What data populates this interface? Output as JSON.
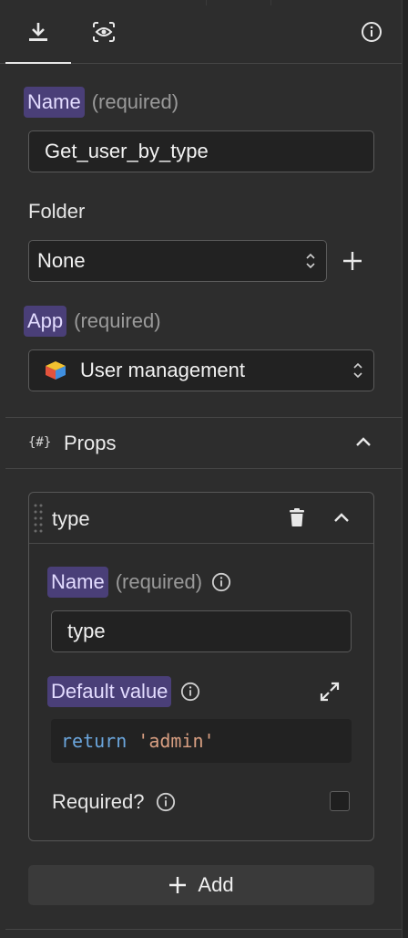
{
  "tabs": [
    {
      "icon": "download-icon",
      "active": true
    },
    {
      "icon": "eye-scan-icon",
      "active": false
    },
    {
      "icon": "info-icon",
      "active": false
    }
  ],
  "form": {
    "name_label": "Name",
    "name_required": "(required)",
    "name_value": "Get_user_by_type",
    "folder_label": "Folder",
    "folder_value": "None",
    "app_label": "App",
    "app_required": "(required)",
    "app_value": "User management"
  },
  "props": {
    "icon_text": "{#}",
    "title": "Props",
    "items": [
      {
        "title": "type",
        "name_label": "Name",
        "name_required": "(required)",
        "name_value": "type",
        "default_label": "Default value",
        "code_keyword": "return",
        "code_string": "'admin'",
        "required_label": "Required?"
      }
    ],
    "add_label": "Add"
  }
}
